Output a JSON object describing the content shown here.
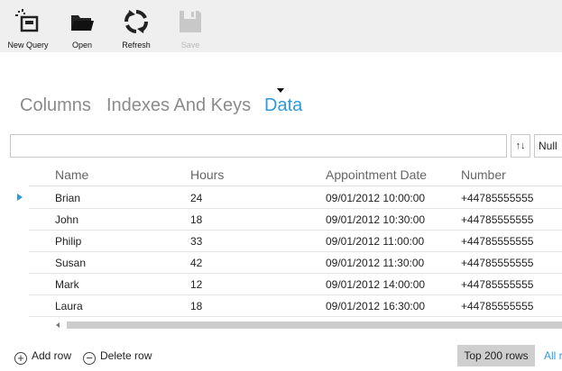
{
  "toolbar": {
    "new_query": "New Query",
    "open": "Open",
    "refresh": "Refresh",
    "save": "Save"
  },
  "tabs": [
    "Columns",
    "Indexes And Keys",
    "Data"
  ],
  "active_tab": "Data",
  "filter": {
    "value": "",
    "placeholder": ""
  },
  "sort_label": "↑↓",
  "null_label": "Null",
  "grid": {
    "columns": [
      "Name",
      "Hours",
      "Appointment Date",
      "Number"
    ],
    "rows": [
      [
        "Brian",
        "24",
        "09/01/2012 10:00:00",
        "+44785555555"
      ],
      [
        "John",
        "18",
        "09/01/2012 10:30:00",
        "+44785555555"
      ],
      [
        "Philip",
        "33",
        "09/01/2012 11:00:00",
        "+44785555555"
      ],
      [
        "Susan",
        "42",
        "09/01/2012 11:30:00",
        "+44785555555"
      ],
      [
        "Mark",
        "12",
        "09/01/2012 14:00:00",
        "+44785555555"
      ],
      [
        "Laura",
        "18",
        "09/01/2012 16:30:00",
        "+44785555555"
      ]
    ],
    "current_row": 0
  },
  "footer": {
    "add_row": "Add row",
    "delete_row": "Delete row",
    "top_rows": "Top 200 rows",
    "all_rows": "All r"
  },
  "colors": {
    "accent": "#2e9bd8",
    "toolbar_bg": "#efefef"
  },
  "icons": [
    "new-query-icon",
    "open-folder-icon",
    "refresh-icon",
    "save-icon",
    "plus-circle-icon",
    "minus-circle-icon"
  ]
}
